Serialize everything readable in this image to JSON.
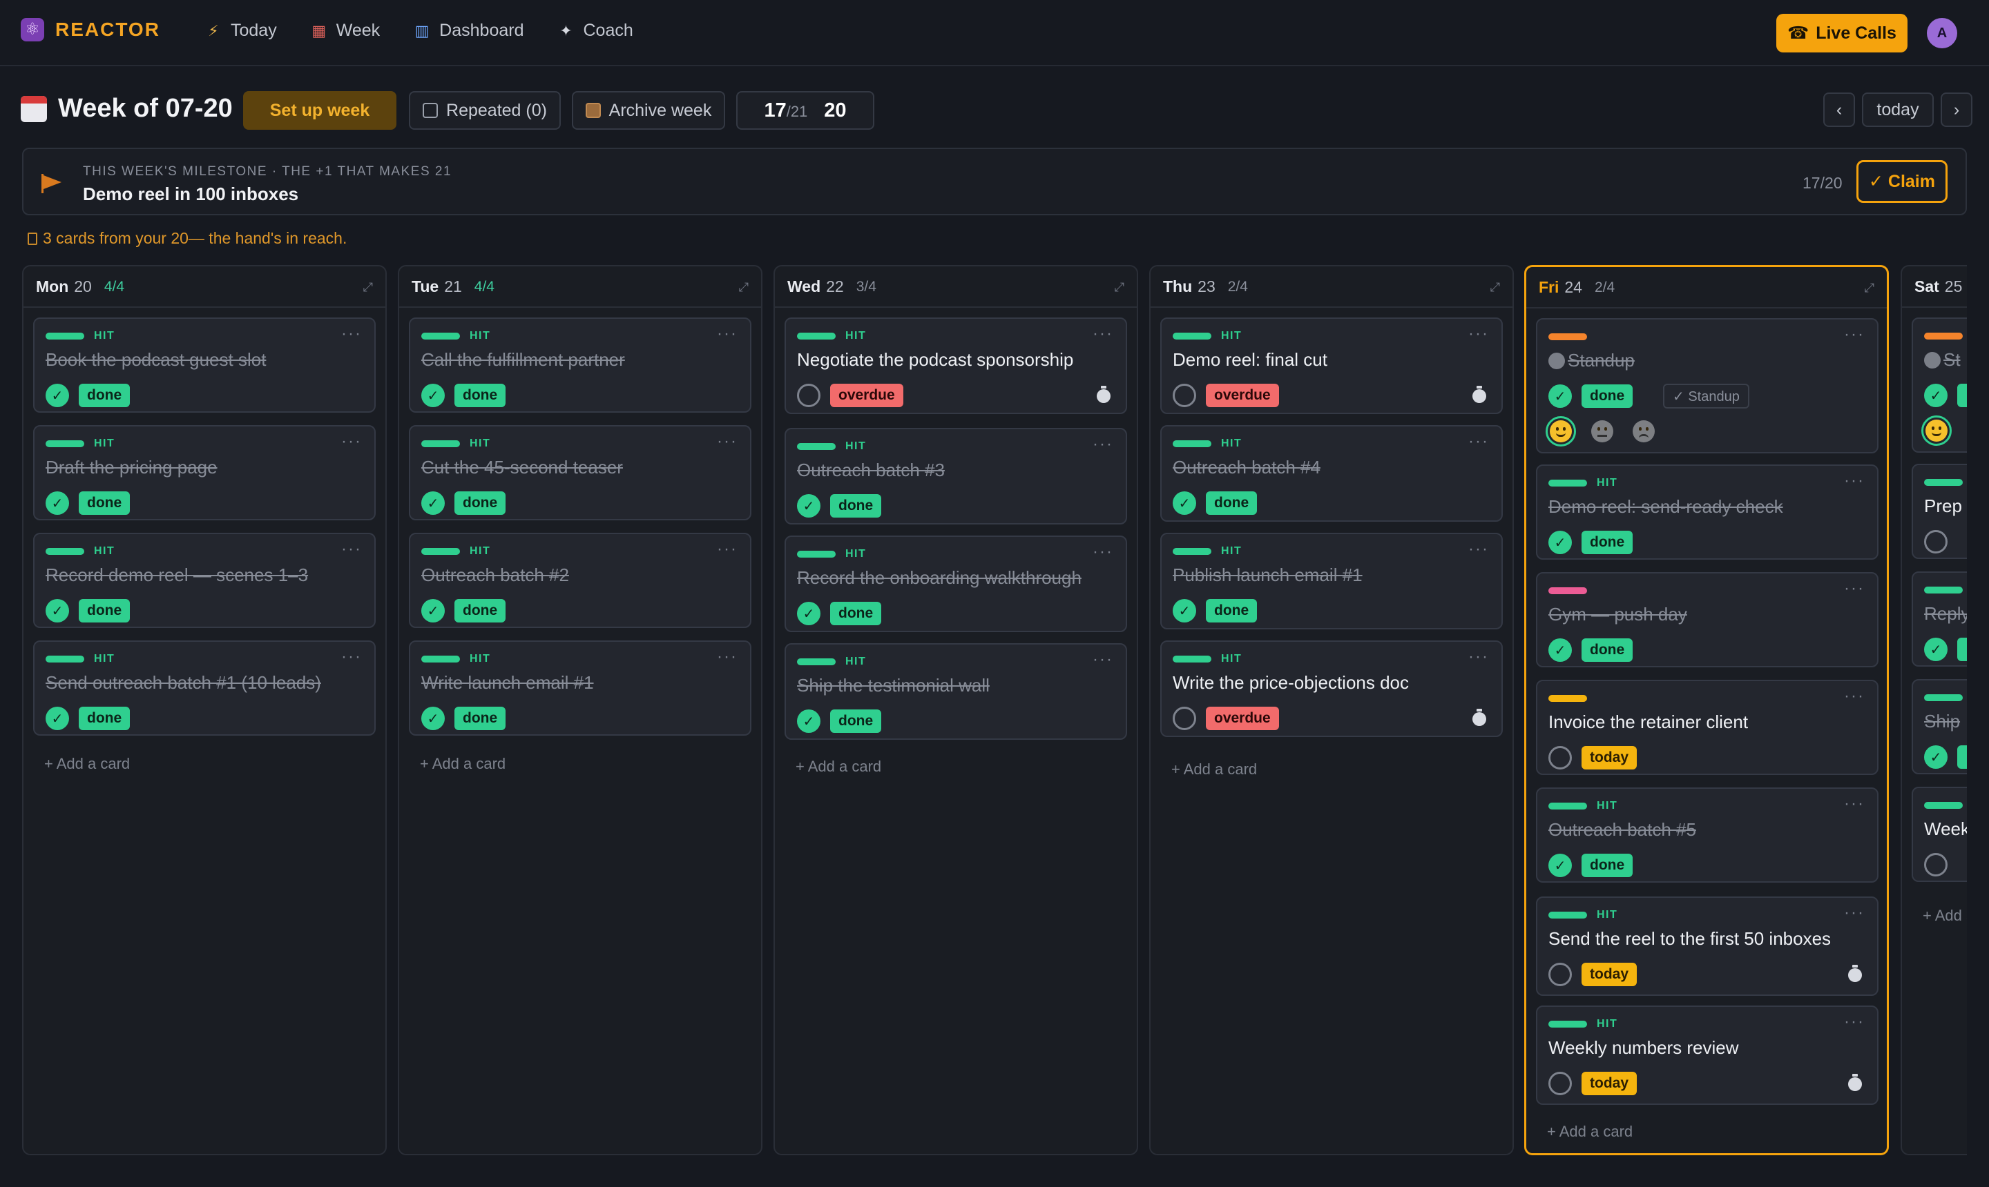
{
  "app": {
    "name": "REACTOR",
    "brand_color": "#f5a524"
  },
  "nav": [
    {
      "label": "Today",
      "icon": "lightning-icon"
    },
    {
      "label": "Week",
      "icon": "calendar-icon"
    },
    {
      "label": "Dashboard",
      "icon": "bar-chart-icon"
    },
    {
      "label": "Coach",
      "icon": "sparkle-icon"
    }
  ],
  "header": {
    "live_calls": "Live Calls",
    "avatar": "A"
  },
  "week": {
    "title": "Week of 07-20",
    "setup": "Set up week",
    "repeated": "Repeated (0)",
    "archive": "Archive week",
    "score_done": "17",
    "score_total": "/21",
    "score_goal": "20",
    "prev": "‹",
    "today": "today",
    "next": "›"
  },
  "milestone": {
    "label": "THIS WEEK'S MILESTONE · THE +1 THAT MAKES 21",
    "title": "Demo reel in 100 inboxes",
    "progress": "17/20",
    "claim": "✓ Claim"
  },
  "hint": "3 cards from your 20— the hand's in reach.",
  "add_card": "+ Add a card",
  "columns": [
    {
      "day": "Mon",
      "date": "20",
      "count": "4/4",
      "cards": [
        {
          "tag": "HIT",
          "title": "Book the podcast guest slot",
          "status": "done"
        },
        {
          "tag": "HIT",
          "title": "Draft the pricing page",
          "status": "done"
        },
        {
          "tag": "HIT",
          "title": "Record demo reel — scenes 1–3",
          "status": "done"
        },
        {
          "tag": "HIT",
          "title": "Send outreach batch #1 (10 leads)",
          "status": "done"
        }
      ]
    },
    {
      "day": "Tue",
      "date": "21",
      "count": "4/4",
      "cards": [
        {
          "tag": "HIT",
          "title": "Call the fulfillment partner",
          "status": "done"
        },
        {
          "tag": "HIT",
          "title": "Cut the 45-second teaser",
          "status": "done"
        },
        {
          "tag": "HIT",
          "title": "Outreach batch #2",
          "status": "done"
        },
        {
          "tag": "HIT",
          "title": "Write launch email #1",
          "status": "done"
        }
      ]
    },
    {
      "day": "Wed",
      "date": "22",
      "count": "3/4",
      "cards": [
        {
          "tag": "HIT",
          "title": "Negotiate the podcast sponsorship",
          "status": "overdue"
        },
        {
          "tag": "HIT",
          "title": "Outreach batch #3",
          "status": "done"
        },
        {
          "tag": "HIT",
          "title": "Record the onboarding walkthrough",
          "status": "done"
        },
        {
          "tag": "HIT",
          "title": "Ship the testimonial wall",
          "status": "done"
        }
      ]
    },
    {
      "day": "Thu",
      "date": "23",
      "count": "2/4",
      "cards": [
        {
          "tag": "HIT",
          "title": "Demo reel: final cut",
          "status": "overdue"
        },
        {
          "tag": "HIT",
          "title": "Outreach batch #4",
          "status": "done"
        },
        {
          "tag": "HIT",
          "title": "Publish launch email #1",
          "status": "done"
        },
        {
          "tag": "HIT",
          "title": "Write the price-objections doc",
          "status": "overdue"
        }
      ]
    },
    {
      "day": "Fri",
      "date": "24",
      "count": "2/4",
      "cards": [
        {
          "tag": "",
          "title": "Standup",
          "status": "done",
          "extra_tag": "✓ Standup"
        },
        {
          "tag": "HIT",
          "title": "Demo reel: send-ready check",
          "status": "done"
        },
        {
          "tag": "",
          "title": "Gym — push day",
          "status": "done"
        },
        {
          "tag": "",
          "title": "Invoice the retainer client",
          "status": "today"
        },
        {
          "tag": "HIT",
          "title": "Outreach batch #5",
          "status": "done"
        },
        {
          "tag": "HIT",
          "title": "Send the reel to the first 50 inboxes",
          "status": "today"
        },
        {
          "tag": "HIT",
          "title": "Weekly numbers review",
          "status": "today"
        }
      ]
    },
    {
      "day": "Sat",
      "date": "25",
      "count": "",
      "cards": [
        {
          "tag": "",
          "title": "St",
          "status": "done"
        },
        {
          "tag": "",
          "title": "Prep",
          "status": ""
        },
        {
          "tag": "",
          "title": "Reply",
          "status": "done"
        },
        {
          "tag": "",
          "title": "Ship",
          "status": "done"
        },
        {
          "tag": "",
          "title": "Week",
          "status": ""
        }
      ]
    }
  ],
  "colors": {
    "hit": "#2fcf8f",
    "orange": "#f5842c",
    "pink": "#ec5c95",
    "yellow": "#f5b40e"
  }
}
